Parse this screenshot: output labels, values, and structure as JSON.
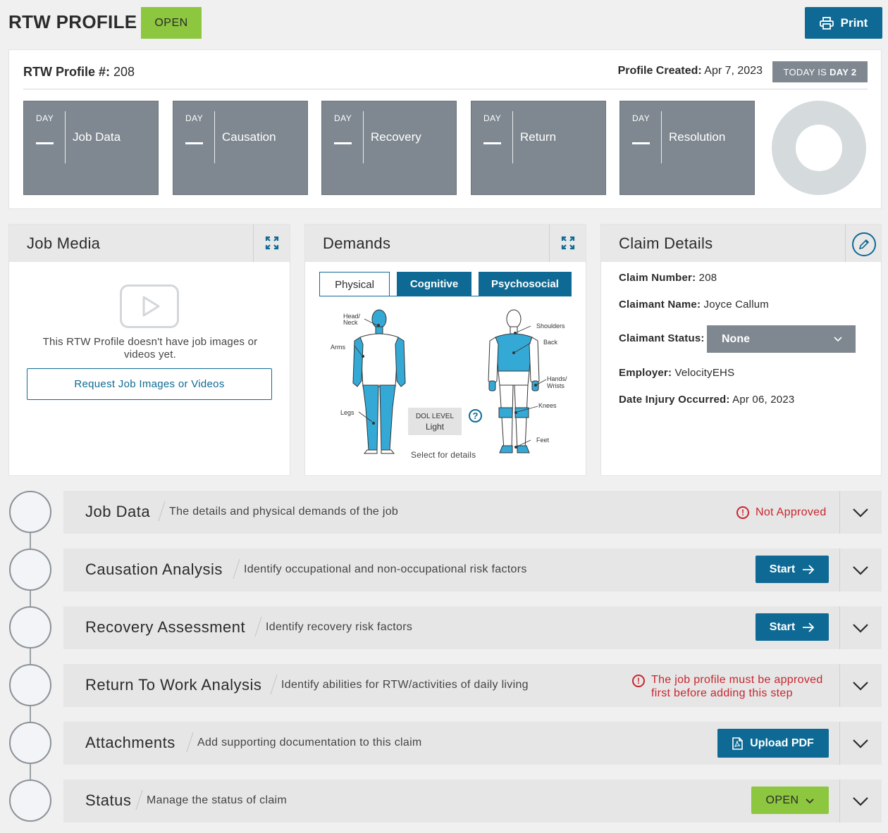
{
  "header": {
    "title": "RTW PROFILE",
    "status_badge": "OPEN",
    "print_label": "Print"
  },
  "profile": {
    "number_label": "RTW Profile #:",
    "number": "208",
    "created_label": "Profile Created:",
    "created_date": "Apr 7, 2023",
    "today_prefix": "TODAY IS ",
    "today_day": "DAY 2",
    "day_tiles": [
      {
        "label": "DAY",
        "name": "Job Data"
      },
      {
        "label": "DAY",
        "name": "Causation"
      },
      {
        "label": "DAY",
        "name": "Recovery"
      },
      {
        "label": "DAY",
        "name": "Return"
      },
      {
        "label": "DAY",
        "name": "Resolution"
      }
    ]
  },
  "job_media": {
    "title": "Job Media",
    "empty_text": "This RTW Profile doesn't have job images or videos yet.",
    "request_label": "Request Job Images or Videos"
  },
  "demands": {
    "title": "Demands",
    "tabs": [
      "Physical",
      "Cognitive",
      "Psychosocial"
    ],
    "body_labels": {
      "head_neck_1": "Head/",
      "head_neck_2": "Neck",
      "arms": "Arms",
      "legs": "Legs",
      "shoulders": "Shoulders",
      "back": "Back",
      "hands_1": "Hands/",
      "hands_2": "Wrists",
      "knees": "Knees",
      "feet": "Feet"
    },
    "dol_label": "DOL LEVEL",
    "dol_value": "Light",
    "hint": "Select for details"
  },
  "claim": {
    "title": "Claim Details",
    "number_label": "Claim Number:",
    "number": "208",
    "name_label": "Claimant Name:",
    "name": "Joyce Callum",
    "status_label": "Claimant Status:",
    "status_value": "None",
    "employer_label": "Employer:",
    "employer": "VelocityEHS",
    "injury_label": "Date Injury Occurred:",
    "injury_date": "Apr 06, 2023"
  },
  "steps": [
    {
      "title": "Job Data",
      "desc": "The details and physical demands of the job",
      "status": "Not Approved"
    },
    {
      "title": "Causation Analysis",
      "desc": "Identify occupational and non-occupational risk factors",
      "action": "Start"
    },
    {
      "title": "Recovery Assessment",
      "desc": "Identify recovery risk factors",
      "action": "Start"
    },
    {
      "title": "Return To Work Analysis",
      "desc": "Identify abilities for RTW/activities of daily living",
      "warning_1": "The job profile must be approved",
      "warning_2": "first before adding this step"
    },
    {
      "title": "Attachments",
      "desc": "Add supporting documentation to this claim",
      "action": "Upload PDF"
    },
    {
      "title": "Status",
      "desc": "Manage the status of claim",
      "action": "OPEN"
    }
  ],
  "colors": {
    "brand": "#0e6a94",
    "open_green": "#8dc63f",
    "tile_gray": "#7f8890",
    "error_red": "#c8262e",
    "body_highlight": "#35a9d6"
  }
}
